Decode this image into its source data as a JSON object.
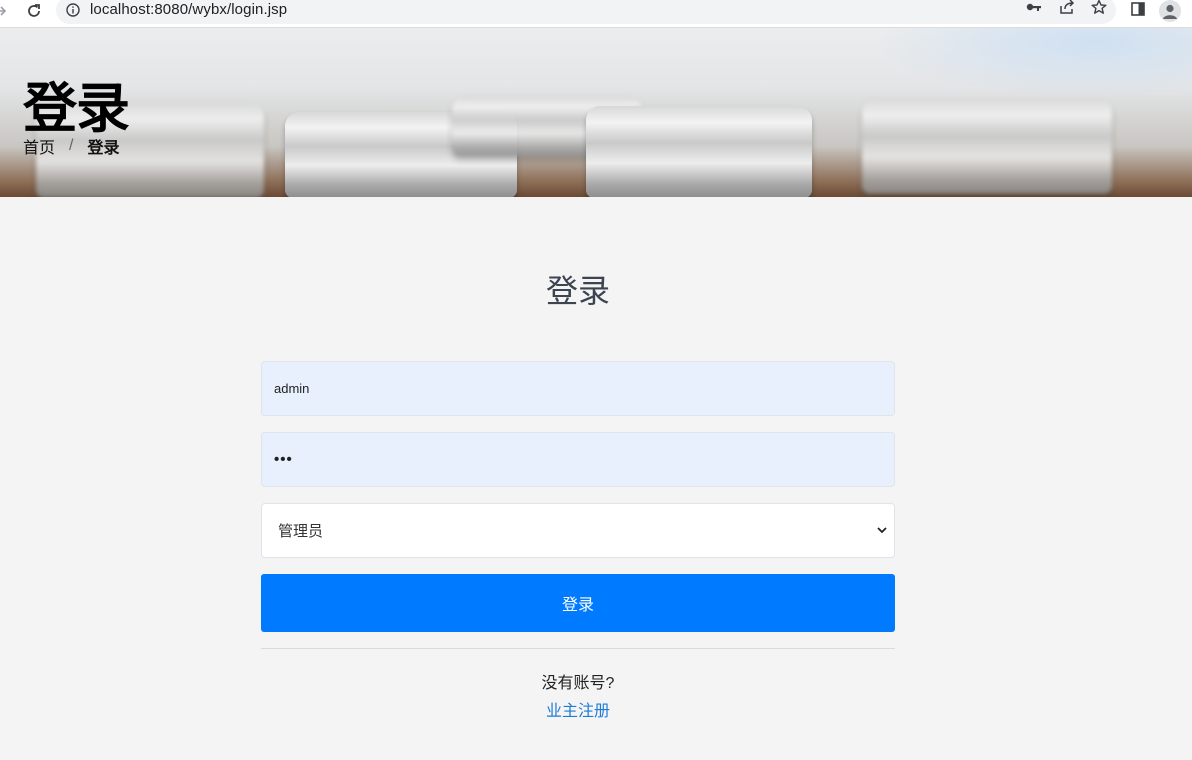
{
  "browser": {
    "url": "localhost:8080/wybx/login.jsp"
  },
  "banner": {
    "title": "登录",
    "breadcrumb": {
      "home": "首页",
      "separator": "/",
      "current": "登录"
    }
  },
  "login": {
    "heading": "登录",
    "username_value": "admin",
    "password_value": "•••",
    "role_selected": "管理员",
    "submit_label": "登录",
    "no_account_text": "没有账号?",
    "register_link": "业主注册"
  },
  "colors": {
    "primary": "#007bff",
    "link": "#1e7bd6",
    "autofill_bg": "#e8f0fe",
    "page_bg": "#f4f4f4"
  }
}
